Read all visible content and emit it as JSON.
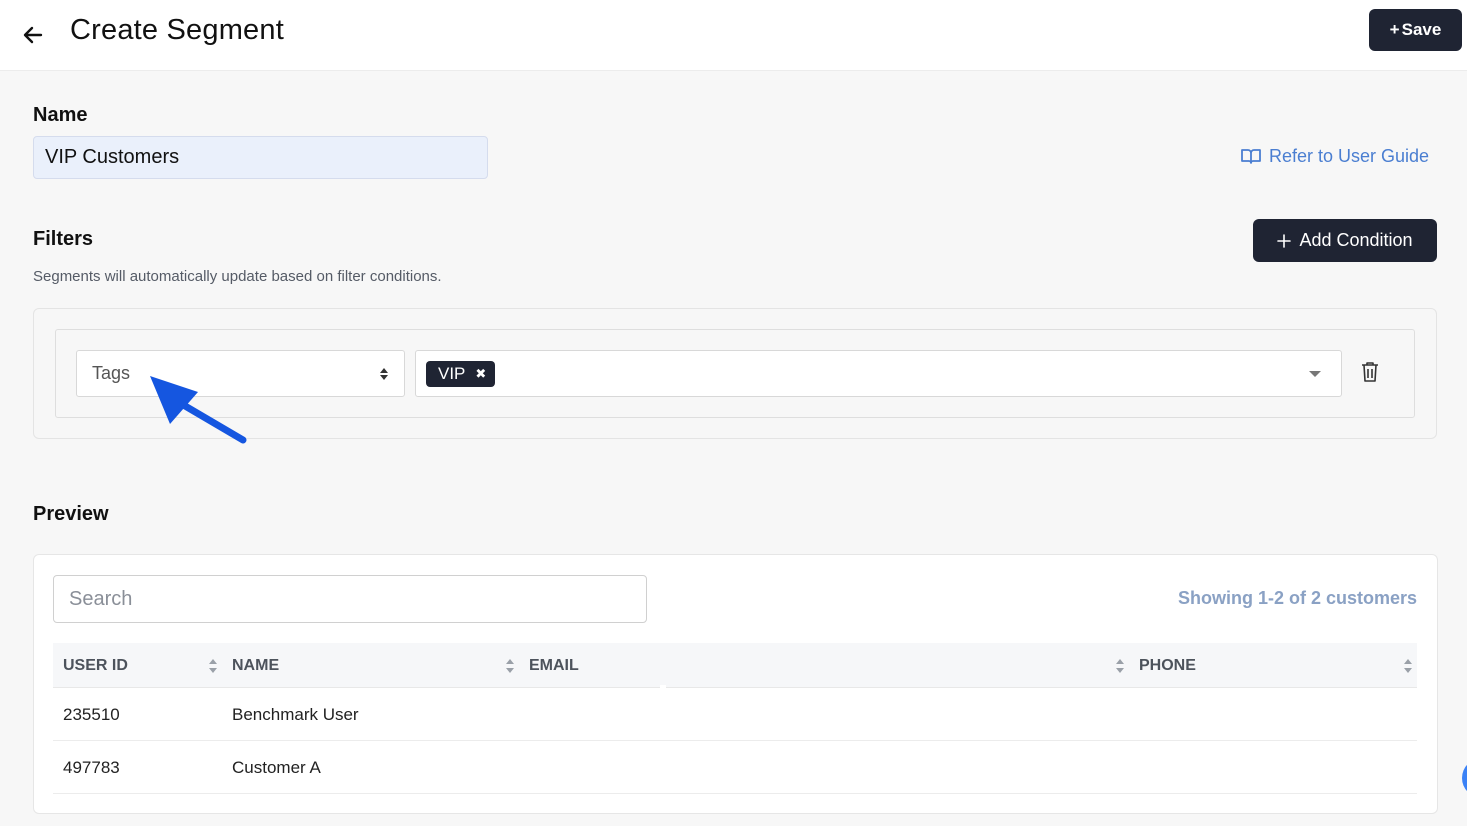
{
  "header": {
    "title": "Create Segment",
    "save_label": "Save"
  },
  "name_section": {
    "label": "Name",
    "value": "VIP Customers",
    "guide_link": "Refer to User Guide"
  },
  "filters": {
    "label": "Filters",
    "description": "Segments will automatically update based on filter conditions.",
    "add_condition_label": "Add Condition",
    "conditions": [
      {
        "field": "Tags",
        "values": [
          "VIP"
        ]
      }
    ]
  },
  "preview": {
    "label": "Preview",
    "search_placeholder": "Search",
    "showing": "Showing 1-2 of 2 customers",
    "columns": [
      "USER ID",
      "NAME",
      "EMAIL",
      "PHONE"
    ],
    "rows": [
      {
        "user_id": "235510",
        "name": "Benchmark User",
        "email": "",
        "phone": ""
      },
      {
        "user_id": "497783",
        "name": "Customer A",
        "email": "",
        "phone": ""
      }
    ]
  },
  "colors": {
    "primary_dark": "#1f2433",
    "link_blue": "#4a7ed1",
    "annotation_arrow": "#1556e0"
  }
}
